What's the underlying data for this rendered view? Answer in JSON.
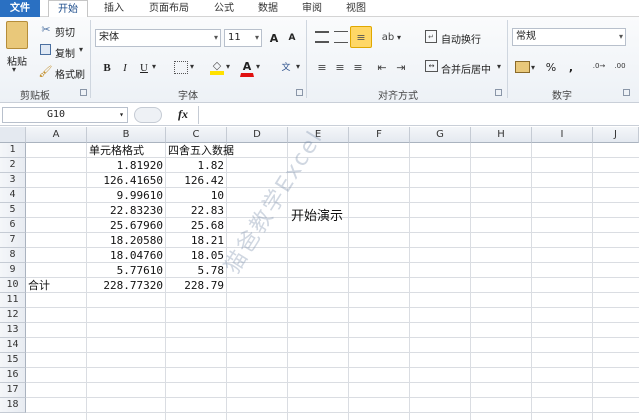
{
  "tabs": [
    "文件",
    "开始",
    "插入",
    "页面布局",
    "公式",
    "数据",
    "审阅",
    "视图"
  ],
  "clipboard": {
    "paste": "粘贴",
    "cut": "剪切",
    "copy": "复制",
    "format_painter": "格式刷",
    "group": "剪贴板"
  },
  "font": {
    "name": "宋体",
    "size": "11",
    "bold": "B",
    "italic": "I",
    "underline": "U",
    "grow": "A",
    "shrink": "A",
    "color_a": "A",
    "wen": "文",
    "group": "字体"
  },
  "alignment": {
    "wrap": "自动换行",
    "merge": "合并后居中",
    "group": "对齐方式"
  },
  "number": {
    "format": "常规",
    "percent": "%",
    "comma": ",",
    "group": "数字"
  },
  "formula_bar": {
    "name_box": "G10",
    "fx": "fx",
    "value": ""
  },
  "columns": [
    "A",
    "B",
    "C",
    "D",
    "E",
    "F",
    "G",
    "H",
    "I",
    "J"
  ],
  "rows": [
    "1",
    "2",
    "3",
    "4",
    "5",
    "6",
    "7",
    "8",
    "9",
    "10",
    "11",
    "12",
    "13",
    "14",
    "15",
    "16",
    "17",
    "18"
  ],
  "sheet": {
    "b1": "单元格格式",
    "c1": "四舍五入数据",
    "data": [
      {
        "b": "1.81920",
        "c": "1.82"
      },
      {
        "b": "126.41650",
        "c": "126.42"
      },
      {
        "b": "9.99610",
        "c": "10"
      },
      {
        "b": "22.83230",
        "c": "22.83"
      },
      {
        "b": "25.67960",
        "c": "25.68"
      },
      {
        "b": "18.20580",
        "c": "18.21"
      },
      {
        "b": "18.04760",
        "c": "18.05"
      },
      {
        "b": "5.77610",
        "c": "5.78"
      },
      {
        "b": "228.77320",
        "c": "228.79"
      }
    ],
    "a10": "合计"
  },
  "demo_text": "开始演示",
  "watermark": "猫爸教学Excel"
}
